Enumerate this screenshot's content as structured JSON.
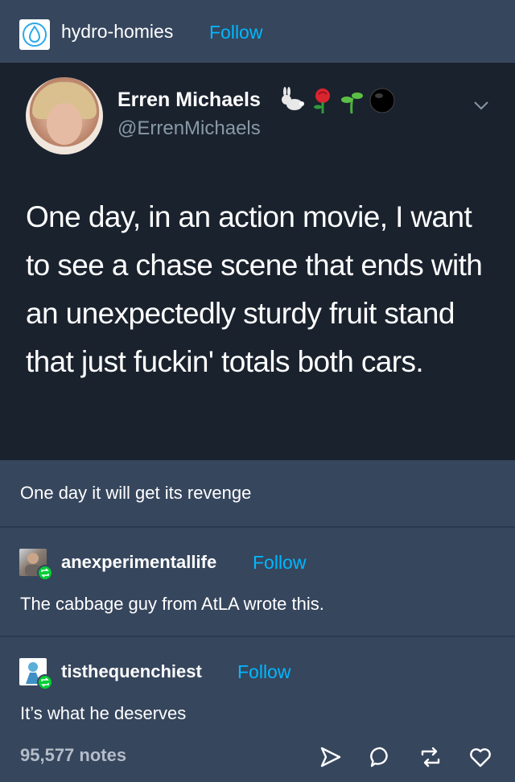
{
  "header": {
    "blog_name": "hydro-homies",
    "follow_label": "Follow"
  },
  "tweet": {
    "display_name": "Erren Michaels",
    "handle": "@ErrenMichaels",
    "emojis": [
      "rabbit-icon",
      "rose-icon",
      "seedling-icon",
      "black-circle-icon"
    ],
    "text": "One day, in an action movie, I want to see a chase scene that ends with an unexpectedly sturdy fruit stand that just fuckin' totals both cars."
  },
  "caption": "One day it will get its revenge",
  "reblogs": [
    {
      "blog_name": "anexperimentallife",
      "follow_label": "Follow",
      "text": "The cabbage guy from AtLA wrote this."
    },
    {
      "blog_name": "tisthequenchiest",
      "follow_label": "Follow",
      "text": "It’s what he deserves"
    }
  ],
  "footer": {
    "notes": "95,577 notes",
    "actions": [
      "share-icon",
      "reply-icon",
      "reblog-icon",
      "like-icon"
    ]
  },
  "colors": {
    "background": "#36465d",
    "tweet_background": "#1a222e",
    "link": "#00b8ff",
    "reblog_badge": "#00cf35"
  }
}
